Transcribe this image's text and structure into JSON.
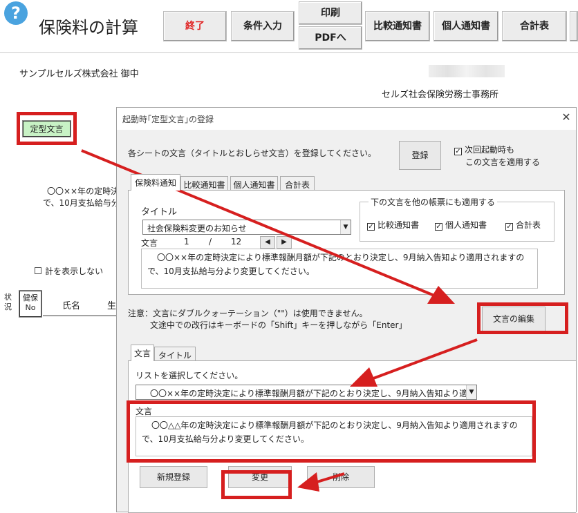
{
  "header": {
    "help_icon_glyph": "?",
    "title": "保険料の計算",
    "buttons": {
      "exit": "終了",
      "condition_input": "条件入力",
      "print": "印刷",
      "pdf": "PDFへ",
      "comparison_notice": "比較通知書",
      "individual_notice": "個人通知書",
      "total_table": "合計表"
    }
  },
  "sheet": {
    "company": "サンプルセルズ株式会社 御中",
    "office": "セルズ社会保険労務士事務所",
    "fixed_text_button": "定型文言",
    "body_line1": "〇〇××年の定時決",
    "body_line2": "で、10月支払給与分よ",
    "hide_total_label": "計を表示しない",
    "col_status": "状況",
    "col_health_no": "健保No",
    "col_name": "氏名",
    "col_birth": "生"
  },
  "dialog": {
    "title": "起動時｢定型文言｣の登録",
    "close_glyph": "✕",
    "instruction": "各シートの文言（タイトルとおしらせ文言）を登録してください。",
    "register_button": "登録",
    "apply_next_startup": {
      "checked": true,
      "line1": "次回起動時も",
      "line2": "この文言を適用する"
    },
    "upper_tabs": [
      "保険料通知",
      "比較通知書",
      "個人通知書",
      "合計表"
    ],
    "apply_group": {
      "title": "下の文言を他の帳票にも適用する",
      "items": [
        {
          "label": "比較通知書",
          "checked": true
        },
        {
          "label": "個人通知書",
          "checked": true
        },
        {
          "label": "合計表",
          "checked": true
        }
      ]
    },
    "title_label": "タイトル",
    "title_value": "社会保険料変更のお知らせ",
    "text_label": "文言",
    "page_current": "1",
    "page_sep": "/",
    "page_total": "12",
    "prev_glyph": "◀",
    "next_glyph": "▶",
    "upper_text_line1": "〇〇××年の定時決定により標準報酬月額が下記のとおり決定し、9月納入告知より適用されますの",
    "upper_text_line2": "で、10月支払給与分より変更してください。",
    "note_line1": "注意：文言にダブルクォーテーション（\"\"）は使用できません。",
    "note_line2": "文途中での改行はキーボードの「Shift」キーを押しながら「Enter」",
    "edit_button": "文言の編集",
    "lower_tabs": [
      "文言",
      "タイトル"
    ],
    "list_prompt": "リストを選択してください。",
    "list_value": "〇〇××年の定時決定により標準報酬月額が下記のとおり決定し、9月納入告知より適",
    "edit_label": "文言",
    "edit_text_line1": "〇〇△△年の定時決定により標準報酬月額が下記のとおり決定し、9月納入告知より適用されますの",
    "edit_text_line2": "で、10月支払給与分より変更してください。",
    "new_button": "新規登録",
    "change_button": "変更",
    "delete_button": "削除"
  },
  "colors": {
    "highlight_red": "#d61f1f",
    "exit_red": "#e02020",
    "help_blue": "#4aa3df",
    "teikei_green": "#c8f2c5"
  }
}
